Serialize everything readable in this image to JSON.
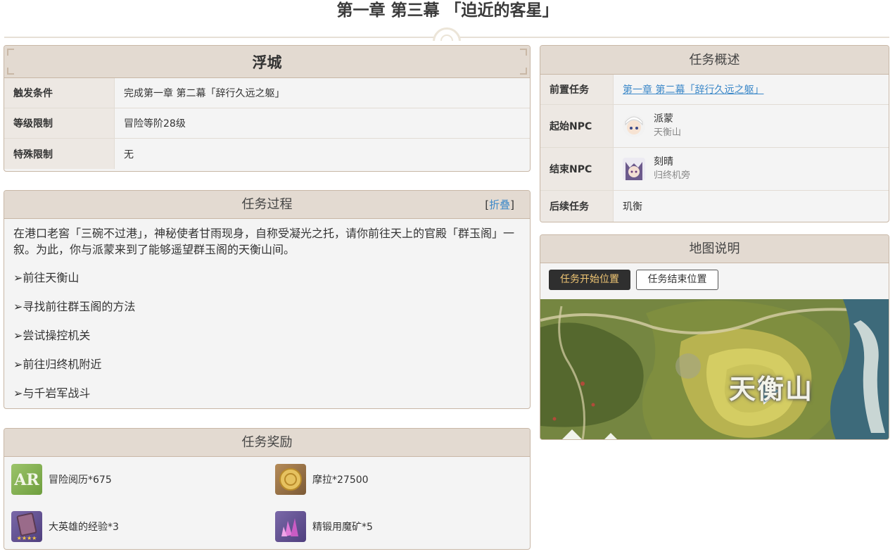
{
  "page_title": "第一章 第三幕 「迫近的客星」",
  "location_panel": {
    "title": "浮城",
    "rows": [
      {
        "key": "触发条件",
        "value": "完成第一章 第二幕「辞行久远之躯」"
      },
      {
        "key": "等级限制",
        "value": "冒险等阶28级"
      },
      {
        "key": "特殊限制",
        "value": "无"
      }
    ]
  },
  "process_panel": {
    "title": "任务过程",
    "fold_open": "[",
    "fold_label": "折叠",
    "fold_close": "]",
    "intro": "在港口老窖「三碗不过港」，神秘使者甘雨现身，自称受凝光之托，请你前往天上的官殿「群玉阁」一叙。为此，你与派蒙来到了能够遥望群玉阁的天衡山间。",
    "steps": [
      "➢前往天衡山",
      "➢寻找前往群玉阁的方法",
      "➢尝试操控机关",
      "➢前往归终机附近",
      "➢与千岩军战斗"
    ]
  },
  "rewards_panel": {
    "title": "任务奖励",
    "items": [
      {
        "label": "冒险阅历*675",
        "icon": "adventure-exp-icon"
      },
      {
        "label": "摩拉*27500",
        "icon": "mora-icon"
      },
      {
        "label": "大英雄的经验*3",
        "icon": "heros-wit-icon",
        "stars": "★★★★"
      },
      {
        "label": "精锻用魔矿*5",
        "icon": "mystic-enhancement-ore-icon"
      }
    ]
  },
  "overview_panel": {
    "title": "任务概述",
    "prev_key": "前置任务",
    "prev_value": "第一章 第二幕「辞行久远之躯」",
    "start_key": "起始NPC",
    "start_npc": {
      "name": "派蒙",
      "location": "天衡山",
      "icon": "paimon-avatar-icon"
    },
    "end_key": "结束NPC",
    "end_npc": {
      "name": "刻晴",
      "location": "归终机旁",
      "icon": "keqing-avatar-icon"
    },
    "next_key": "后续任务",
    "next_value": "玑衡"
  },
  "map_panel": {
    "title": "地图说明",
    "btn_start": "任务开始位置",
    "btn_end": "任务结束位置",
    "map_label": "天衡山"
  }
}
